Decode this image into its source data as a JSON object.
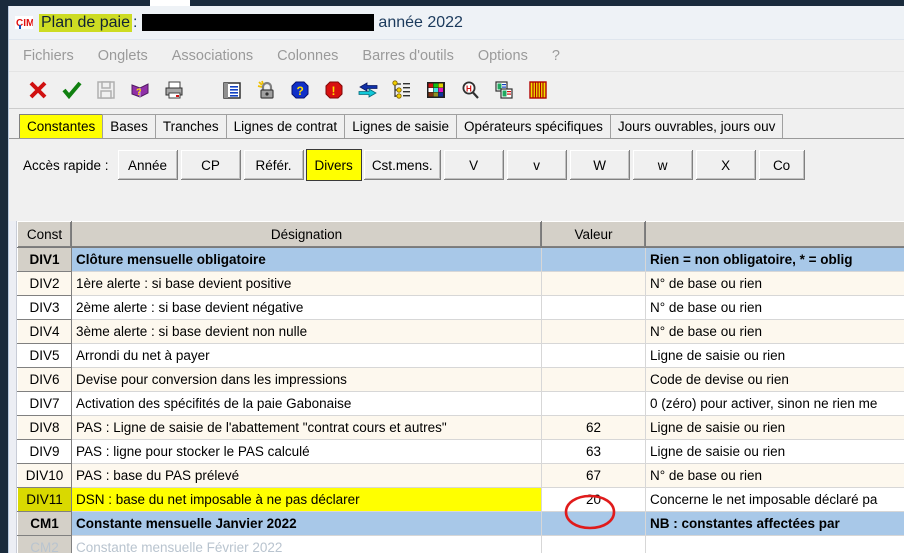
{
  "window": {
    "app_icon": "cim-logo-icon",
    "title_prefix": "Plan de paie",
    "title_colon": ":",
    "title_redacted": "",
    "title_suffix": "année 2022"
  },
  "menubar": {
    "items": [
      {
        "label": "Fichiers",
        "name": "menu-fichiers"
      },
      {
        "label": "Onglets",
        "name": "menu-onglets"
      },
      {
        "label": "Associations",
        "name": "menu-associations"
      },
      {
        "label": "Colonnes",
        "name": "menu-colonnes"
      },
      {
        "label": "Barres d'outils",
        "name": "menu-barres-outils"
      },
      {
        "label": "Options",
        "name": "menu-options"
      },
      {
        "label": "?",
        "name": "menu-aide"
      }
    ]
  },
  "toolbar": {
    "buttons": [
      {
        "icon": "cancel-cross-icon",
        "label": "Annuler"
      },
      {
        "icon": "validate-check-icon",
        "label": "Valider"
      },
      {
        "icon": "save-floppy-icon",
        "label": "Enregistrer"
      },
      {
        "icon": "help-book-icon",
        "label": "Aide"
      },
      {
        "icon": "print-icon",
        "label": "Imprimer"
      },
      {
        "icon": "list-columns-icon",
        "label": "Colonnes"
      },
      {
        "icon": "lock-icon",
        "label": "Verrouiller"
      },
      {
        "icon": "question-help-icon",
        "label": "Aide contextuelle"
      },
      {
        "icon": "warning-exclamation-icon",
        "label": "Avertissement"
      },
      {
        "icon": "transfer-arrows-icon",
        "label": "Transfert"
      },
      {
        "icon": "tree-structure-icon",
        "label": "Arborescence"
      },
      {
        "icon": "color-palette-icon",
        "label": "Couleurs"
      },
      {
        "icon": "search-magnifier-icon",
        "label": "Rechercher"
      },
      {
        "icon": "copy-pages-icon",
        "label": "Dupliquer"
      },
      {
        "icon": "bellows-icon",
        "label": "Outil"
      }
    ]
  },
  "tabs": [
    {
      "label": "Constantes",
      "active": true
    },
    {
      "label": "Bases",
      "active": false
    },
    {
      "label": "Tranches",
      "active": false
    },
    {
      "label": "Lignes de contrat",
      "active": false
    },
    {
      "label": "Lignes de saisie",
      "active": false
    },
    {
      "label": "Opérateurs spécifiques",
      "active": false
    },
    {
      "label": "Jours ouvrables, jours ouv",
      "active": false
    }
  ],
  "quick_access": {
    "label": "Accès rapide :",
    "buttons": [
      {
        "label": "Année",
        "active": false,
        "wide": true
      },
      {
        "label": "CP",
        "active": false,
        "wide": true
      },
      {
        "label": "Référ.",
        "active": false,
        "wide": true
      },
      {
        "label": "Divers",
        "active": true,
        "wide": false
      },
      {
        "label": "Cst.mens.",
        "active": false,
        "wide": false
      },
      {
        "label": "V",
        "active": false,
        "wide": true
      },
      {
        "label": "v",
        "active": false,
        "wide": true
      },
      {
        "label": "W",
        "active": false,
        "wide": true
      },
      {
        "label": "w",
        "active": false,
        "wide": true
      },
      {
        "label": "X",
        "active": false,
        "wide": true
      },
      {
        "label": "Co",
        "active": false,
        "wide": false
      }
    ]
  },
  "grid": {
    "columns": [
      "Const",
      "Désignation",
      "Valeur",
      ""
    ],
    "rows": [
      {
        "const": "DIV1",
        "designation": "Clôture mensuelle obligatoire",
        "valeur": "",
        "note": "Rien = non obligatoire, * = oblig",
        "state": "sel"
      },
      {
        "const": "DIV2",
        "designation": "1ère alerte : si base devient positive",
        "valeur": "",
        "note": "N° de base ou rien",
        "state": "odd"
      },
      {
        "const": "DIV3",
        "designation": "2ème alerte : si base devient négative",
        "valeur": "",
        "note": "N° de base ou rien",
        "state": "even"
      },
      {
        "const": "DIV4",
        "designation": "3ème alerte : si base devient non nulle",
        "valeur": "",
        "note": "N° de base ou rien",
        "state": "odd"
      },
      {
        "const": "DIV5",
        "designation": "Arrondi du net à payer",
        "valeur": "",
        "note": "Ligne de saisie ou rien",
        "state": "even"
      },
      {
        "const": "DIV6",
        "designation": "Devise pour conversion dans les impressions",
        "valeur": "",
        "note": "Code de devise ou rien",
        "state": "odd"
      },
      {
        "const": "DIV7",
        "designation": "Activation des spécifités de la paie Gabonaise",
        "valeur": "",
        "note": "0 (zéro) pour activer, sinon ne rien me",
        "state": "even"
      },
      {
        "const": "DIV8",
        "designation": "PAS : Ligne de saisie de l'abattement \"contrat cours et autres\"",
        "valeur": "62",
        "note": "Ligne de saisie ou rien",
        "state": "odd"
      },
      {
        "const": "DIV9",
        "designation": "PAS : ligne pour stocker le PAS calculé",
        "valeur": "63",
        "note": "Ligne de saisie ou rien",
        "state": "even"
      },
      {
        "const": "DIV10",
        "designation": "PAS : base du PAS prélevé",
        "valeur": "67",
        "note": "N° de base ou rien",
        "state": "odd"
      },
      {
        "const": "DIV11",
        "designation": "DSN : base du net imposable à ne pas déclarer",
        "valeur": "20",
        "note": "Concerne le net imposable déclaré pa",
        "state": "hl"
      },
      {
        "const": "CM1",
        "designation": "Constante mensuelle Janvier 2022",
        "valeur": "",
        "note": "NB : constantes affectées par",
        "state": "sel"
      },
      {
        "const": "CM2",
        "designation": "Constante mensuelle Février 2022",
        "valeur": "",
        "note": "",
        "state": "cut"
      }
    ]
  },
  "annotation": {
    "type": "red-ellipse",
    "target_value": "20",
    "color": "#e01b1b"
  }
}
